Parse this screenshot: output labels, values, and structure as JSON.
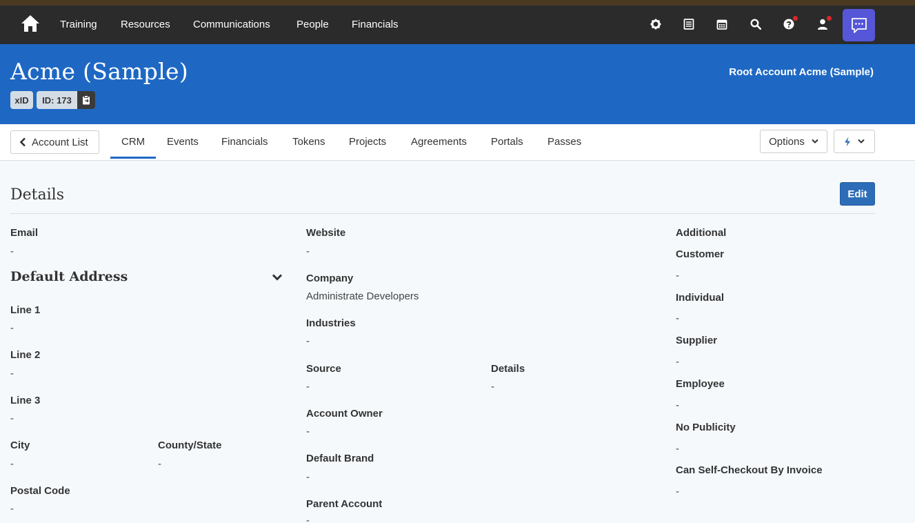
{
  "nav": {
    "links": [
      "Training",
      "Resources",
      "Communications",
      "People",
      "Financials"
    ],
    "icons": [
      "gear-icon",
      "list-icon",
      "calendar-icon",
      "search-icon",
      "help-icon",
      "user-icon",
      "chat-icon"
    ]
  },
  "header": {
    "title": "Acme (Sample)",
    "xid_label": "xID",
    "id_label": "ID: 173",
    "root_account": "Root Account Acme (Sample)"
  },
  "tabbar": {
    "back_label": "Account List",
    "tabs": [
      "CRM",
      "Events",
      "Financials",
      "Tokens",
      "Projects",
      "Agreements",
      "Portals",
      "Passes"
    ],
    "active_tab": "CRM",
    "options_label": "Options"
  },
  "details": {
    "title": "Details",
    "edit_label": "Edit",
    "email": {
      "label": "Email",
      "value": "-"
    },
    "default_address": {
      "title": "Default Address",
      "line1": {
        "label": "Line 1",
        "value": "-"
      },
      "line2": {
        "label": "Line 2",
        "value": "-"
      },
      "line3": {
        "label": "Line 3",
        "value": "-"
      },
      "city": {
        "label": "City",
        "value": "-"
      },
      "county_state": {
        "label": "County/State",
        "value": "-"
      },
      "postal_code": {
        "label": "Postal Code",
        "value": "-"
      }
    },
    "website": {
      "label": "Website",
      "value": "-"
    },
    "company": {
      "label": "Company",
      "value": "Administrate Developers"
    },
    "industries": {
      "label": "Industries",
      "value": "-"
    },
    "source": {
      "label": "Source",
      "value": "-"
    },
    "source_details": {
      "label": "Details",
      "value": "-"
    },
    "account_owner": {
      "label": "Account Owner",
      "value": "-"
    },
    "default_brand": {
      "label": "Default Brand",
      "value": "-"
    },
    "parent_account": {
      "label": "Parent Account",
      "value": "-"
    },
    "additional": {
      "title": "Additional",
      "customer": {
        "label": "Customer",
        "value": "-"
      },
      "individual": {
        "label": "Individual",
        "value": "-"
      },
      "supplier": {
        "label": "Supplier",
        "value": "-"
      },
      "employee": {
        "label": "Employee",
        "value": "-"
      },
      "no_publicity": {
        "label": "No Publicity",
        "value": "-"
      },
      "self_checkout": {
        "label": "Can Self-Checkout By Invoice",
        "value": "-"
      }
    }
  },
  "colors": {
    "navbar": "#2b2b2b",
    "header": "#1e68c4",
    "chat_button": "#5656d8",
    "edit_button": "#2d6db8",
    "notification_dot": "#d9262c"
  }
}
